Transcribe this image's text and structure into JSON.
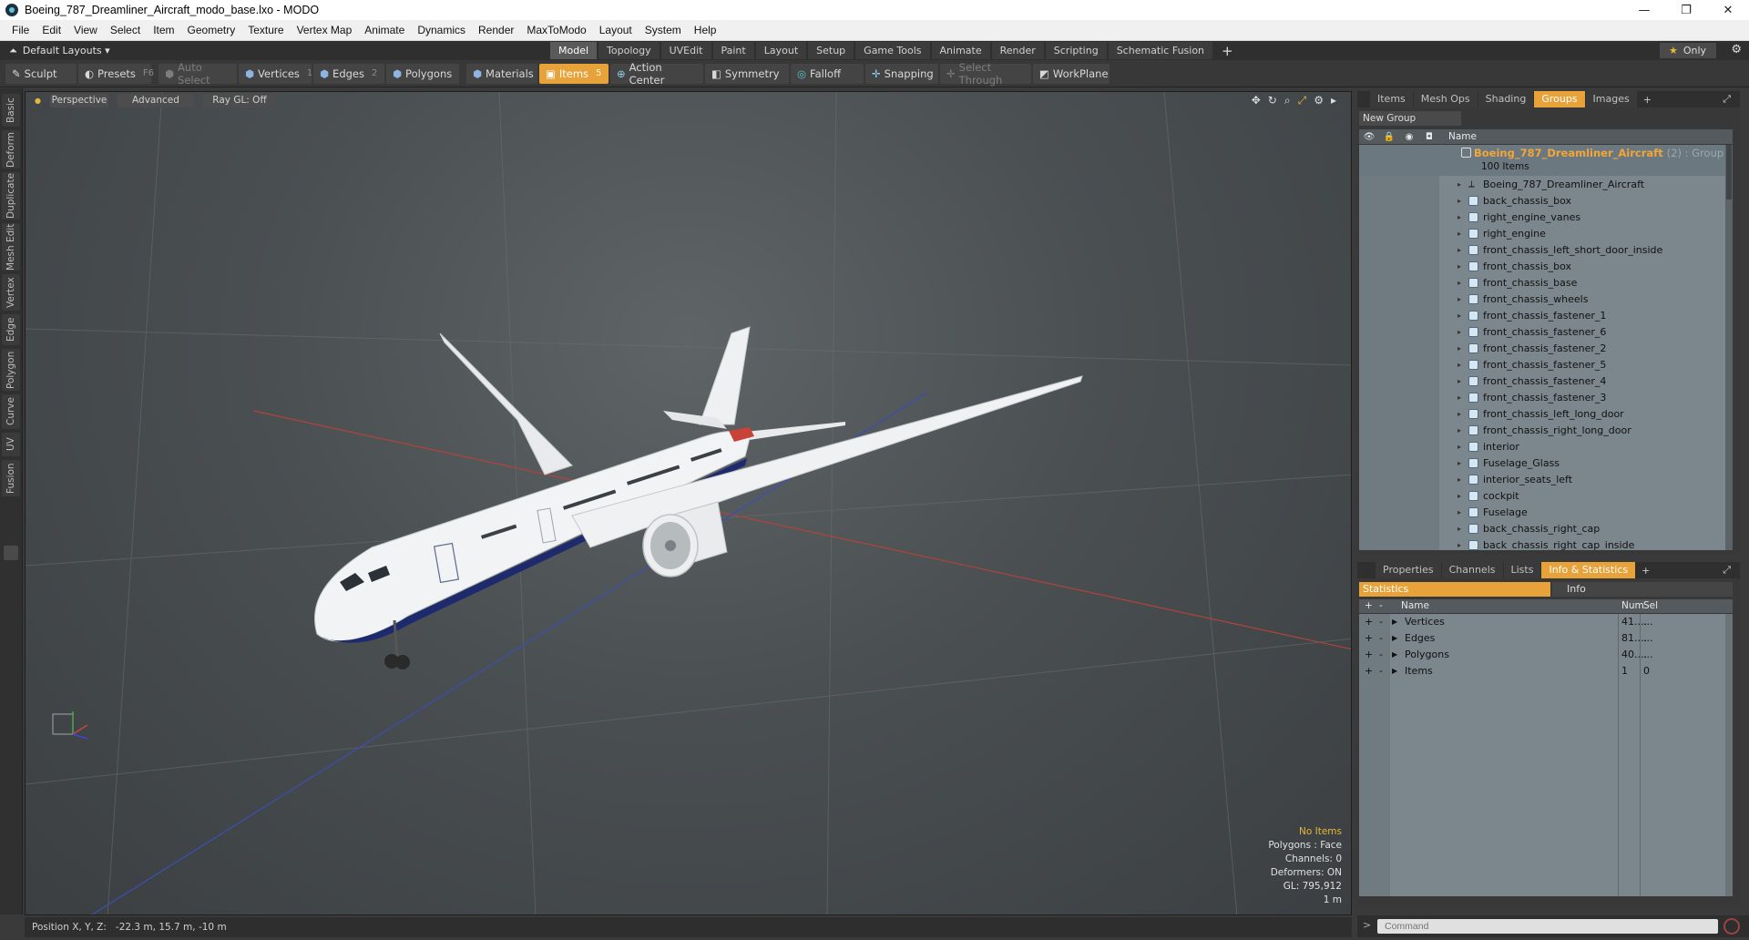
{
  "window": {
    "title": "Boeing_787_Dreamliner_Aircraft_modo_base.lxo - MODO",
    "controls": [
      "—",
      "❐",
      "✕"
    ]
  },
  "menu": [
    "File",
    "Edit",
    "View",
    "Select",
    "Item",
    "Geometry",
    "Texture",
    "Vertex Map",
    "Animate",
    "Dynamics",
    "Render",
    "MaxToModo",
    "Layout",
    "System",
    "Help"
  ],
  "layout_bar": {
    "layouts_label": "Default Layouts ▾",
    "tabs": [
      "Model",
      "Topology",
      "UVEdit",
      "Paint",
      "Layout",
      "Setup",
      "Game Tools",
      "Animate",
      "Render",
      "Scripting",
      "Schematic Fusion"
    ],
    "active_tab": "Model",
    "only_label": "Only",
    "only_star": "★"
  },
  "toolbar": {
    "sculpt": "Sculpt",
    "presets": "Presets",
    "presets_key": "F6",
    "auto_select": "Auto Select",
    "vertices": "Vertices",
    "vertices_key": "1",
    "edges": "Edges",
    "edges_key": "2",
    "polygons": "Polygons",
    "materials": "Materials",
    "items": "Items",
    "items_key": "5",
    "action_center": "Action Center",
    "symmetry": "Symmetry",
    "falloff": "Falloff",
    "snapping": "Snapping",
    "select_through": "Select Through",
    "workplane": "WorkPlane"
  },
  "left_tabs": [
    "Basic",
    "Deform",
    "Duplicate",
    "Mesh Edit",
    "Vertex",
    "Edge",
    "Polygon",
    "Curve",
    "UV",
    "Fusion"
  ],
  "viewport": {
    "perspective": "Perspective",
    "advanced": "Advanced",
    "raygl": "Ray GL: Off",
    "info_no_items": "No Items",
    "info_polygons": "Polygons : Face",
    "info_channels": "Channels: 0",
    "info_deformers": "Deformers: ON",
    "info_gl": "GL: 795,912",
    "info_scale": "1 m"
  },
  "status": {
    "position_label": "Position X, Y, Z:",
    "position_value": "-22.3 m, 15.7 m, -10 m"
  },
  "groups_panel": {
    "tabs": [
      "Items",
      "Mesh Ops",
      "Shading",
      "Groups",
      "Images"
    ],
    "active_tab": "Groups",
    "new_group": "New Group",
    "name_header": "Name",
    "group_name": "Boeing_787_Dreamliner_Aircraft",
    "group_suffix": "(2) : Group",
    "group_count": "100 Items",
    "items": [
      "Boeing_787_Dreamliner_Aircraft",
      "back_chassis_box",
      "right_engine_vanes",
      "right_engine",
      "front_chassis_left_short_door_inside",
      "front_chassis_box",
      "front_chassis_base",
      "front_chassis_wheels",
      "front_chassis_fastener_1",
      "front_chassis_fastener_6",
      "front_chassis_fastener_2",
      "front_chassis_fastener_5",
      "front_chassis_fastener_4",
      "front_chassis_fastener_3",
      "front_chassis_left_long_door",
      "front_chassis_right_long_door",
      "interior",
      "Fuselage_Glass",
      "interior_seats_left",
      "cockpit",
      "Fuselage",
      "back_chassis_right_cap",
      "back_chassis_right_cap_inside"
    ]
  },
  "stats_panel": {
    "tabs": [
      "Properties",
      "Channels",
      "Lists",
      "Info & Statistics"
    ],
    "active_tab": "Info & Statistics",
    "sub_tabs": [
      "Statistics",
      "Info"
    ],
    "headers": {
      "plus": "+",
      "minus": "-",
      "name": "Name",
      "num": "Num",
      "sel": "Sel"
    },
    "rows": [
      {
        "name": "Vertices",
        "num": "41....",
        "sel": "..."
      },
      {
        "name": "Edges",
        "num": "81....",
        "sel": "..."
      },
      {
        "name": "Polygons",
        "num": "40....",
        "sel": "..."
      },
      {
        "name": "Items",
        "num": "1",
        "sel": "0"
      }
    ]
  },
  "command": {
    "placeholder": "Command",
    "arrow": ">"
  },
  "colors": {
    "accent": "#e8a23a",
    "group_name": "#f2a63a",
    "panel_bg": "#7c868d",
    "viewport_bg": "#4a4f52"
  }
}
